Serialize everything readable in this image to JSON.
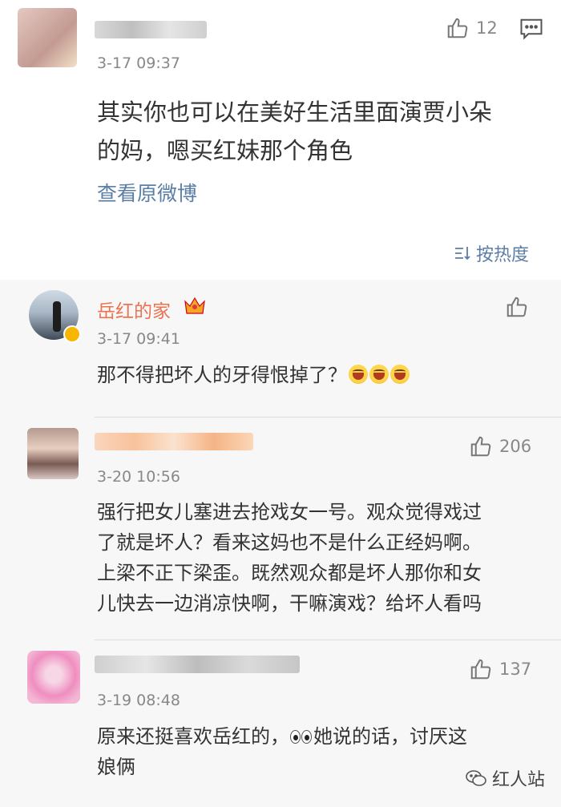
{
  "top_comment": {
    "time": "3-17 09:37",
    "likes": "12",
    "text_lines": [
      "其实你也可以在美好生活里面演贾小朵",
      "的妈，嗯买红妹那个角色"
    ],
    "view_original": "查看原微博"
  },
  "sort_label": "按热度",
  "replies": [
    {
      "name": "岳红的家",
      "time": "3-17 09:41",
      "likes": "",
      "text_lines": [
        "那不得把坏人的牙得恨掉了？"
      ]
    },
    {
      "time": "3-20 10:56",
      "likes": "206",
      "text_lines": [
        "强行把女儿塞进去抢戏女一号。观众觉得戏过",
        "了就是坏人？看来这妈也不是什么正经妈啊。",
        "上梁不正下梁歪。既然观众都是坏人那你和女",
        "儿快去一边消凉快啊，干嘛演戏？给坏人看吗"
      ]
    },
    {
      "time": "3-19 08:48",
      "likes": "137",
      "text_lines": [
        "原来还挺喜欢岳红的，",
        "她说的话，讨厌这",
        "娘俩"
      ]
    }
  ],
  "watermark": "红人站",
  "icons": {
    "like": "thumbs-up-icon",
    "comment": "comment-icon",
    "sort": "sort-icon",
    "crown": "crown-icon",
    "verified": "verified-icon"
  }
}
